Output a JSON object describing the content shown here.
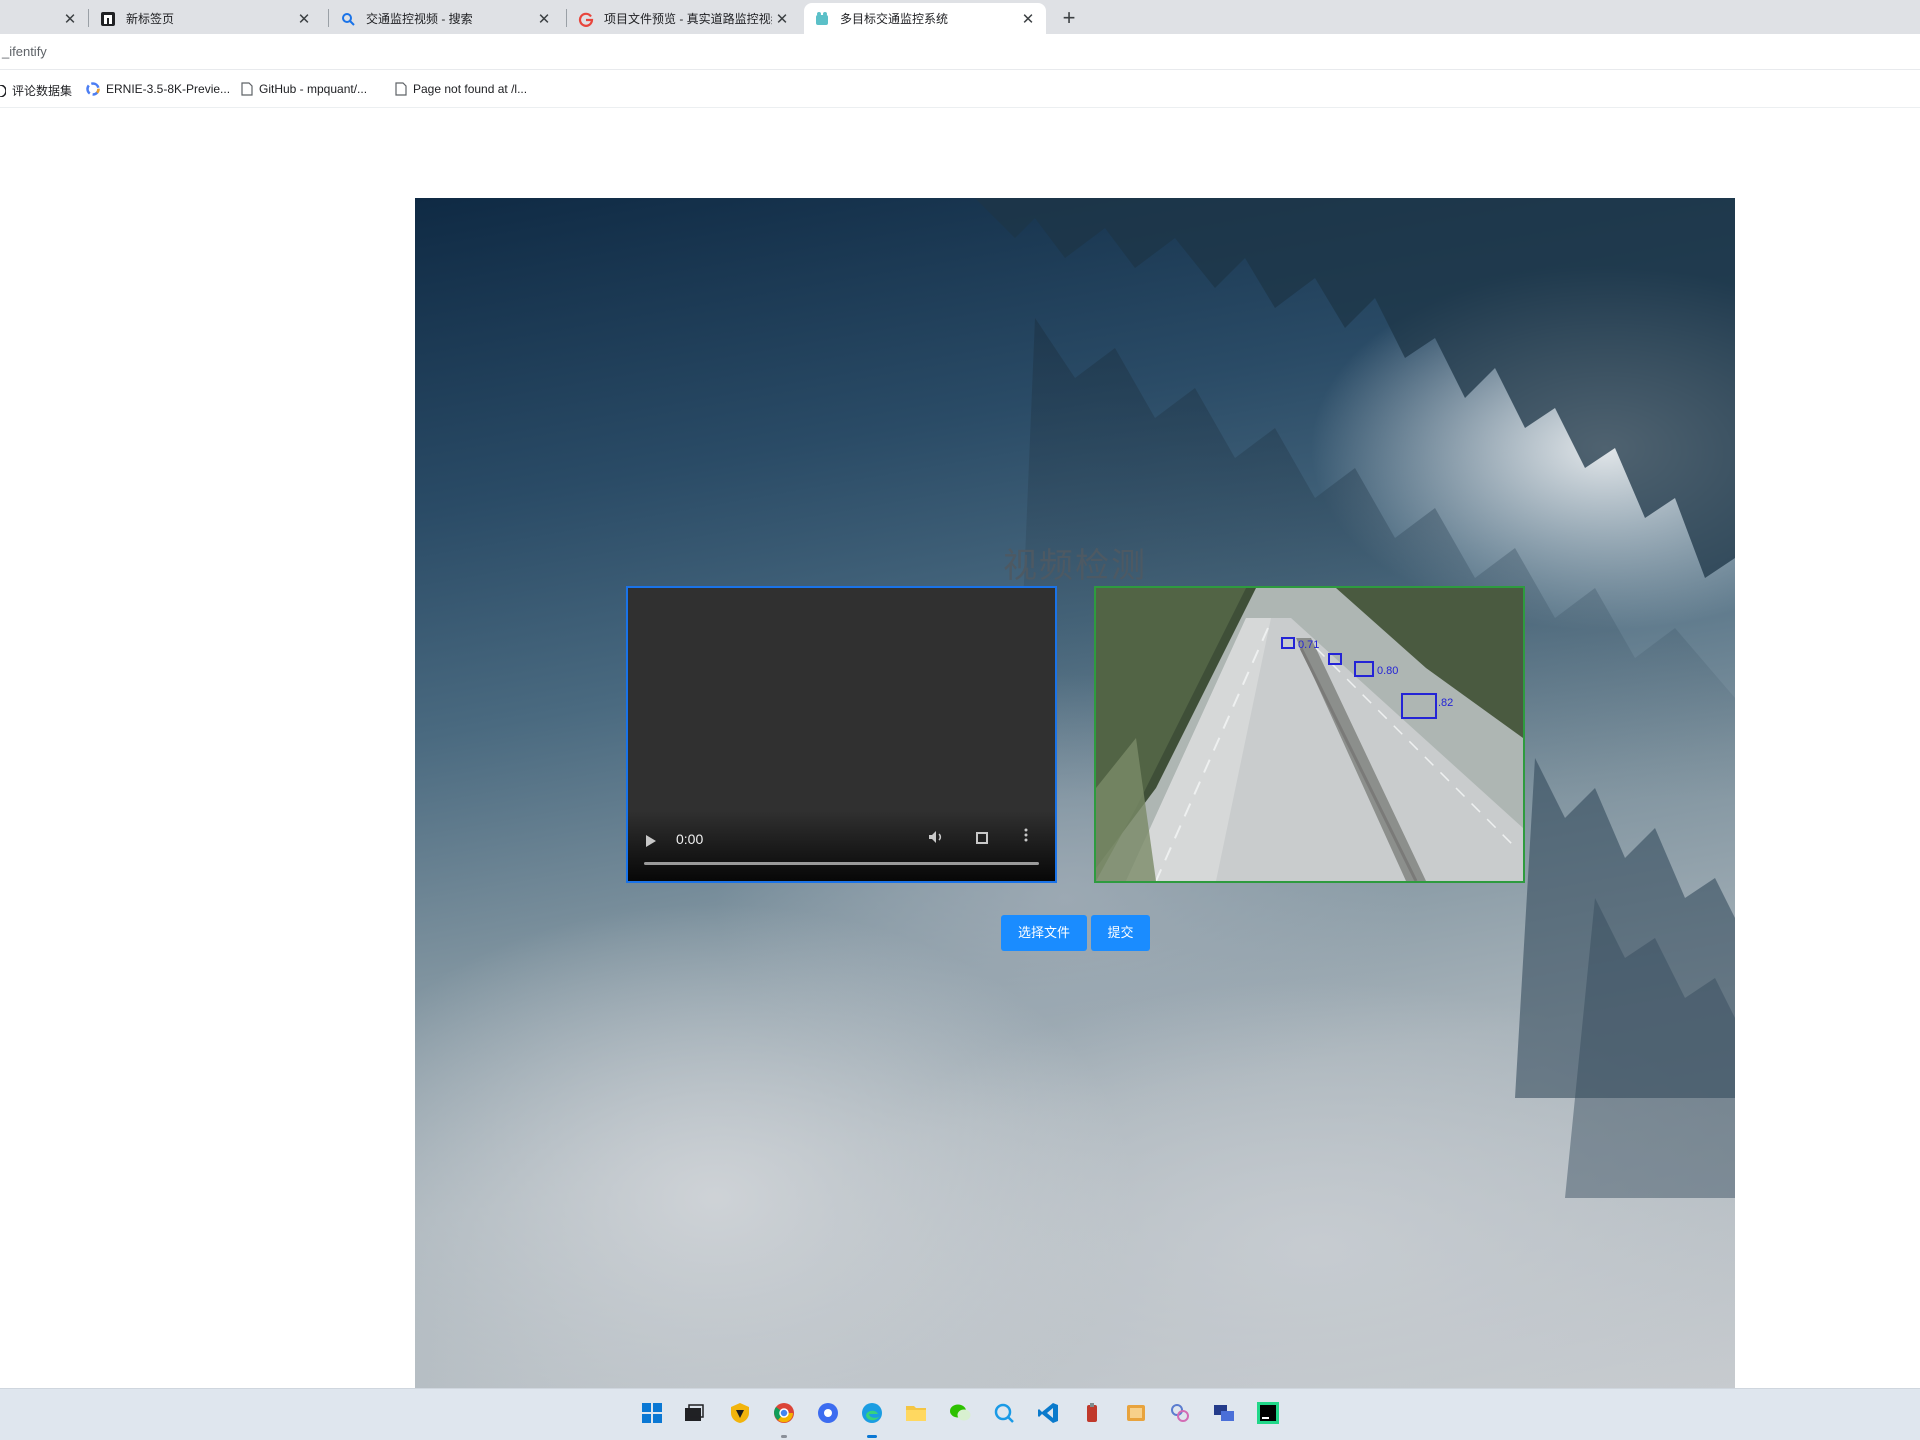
{
  "browser": {
    "tabs": [
      {
        "title": "",
        "icon": "blank-tab-icon"
      },
      {
        "title": "新标签页",
        "icon": "new-tab-page-icon"
      },
      {
        "title": "交通监控视频 - 搜索",
        "icon": "search-icon"
      },
      {
        "title": "项目文件预览 - 真实道路监控视频",
        "icon": "g-logo-icon"
      },
      {
        "title": "多目标交通监控系统",
        "icon": "app-icon",
        "active": true
      }
    ],
    "new_tab_label": "+",
    "close_label": "✕",
    "url": "_ifentify",
    "bookmarks": [
      {
        "label": "评论数据集",
        "icon": "circle-icon"
      },
      {
        "label": "ERNIE-3.5-8K-Previe...",
        "icon": "ernie-icon"
      },
      {
        "label": "GitHub - mpquant/...",
        "icon": "page-icon"
      },
      {
        "label": "Page not found at /l...",
        "icon": "page-icon"
      }
    ]
  },
  "page": {
    "title": "视频检测",
    "video": {
      "time": "0:00"
    },
    "detections": [
      {
        "label": "0.71"
      },
      {
        "label": ""
      },
      {
        "label": "0.80"
      },
      {
        "label": ".82"
      }
    ],
    "buttons": {
      "choose": "选择文件",
      "submit": "提交"
    },
    "colors": {
      "accent_button": "#1a8cff",
      "video_border": "#1a73e8",
      "result_border": "#2e9b3f",
      "detection_box": "#2424d6"
    }
  },
  "taskbar": {
    "icons": [
      "windows-start-icon",
      "task-view-icon",
      "security-icon",
      "chrome-icon",
      "browser-icon",
      "edge-icon",
      "file-explorer-icon",
      "wechat-icon",
      "search-app-icon",
      "vscode-icon",
      "tool-icon",
      "archive-icon",
      "app-icon",
      "remote-icon",
      "pycharm-icon"
    ]
  }
}
